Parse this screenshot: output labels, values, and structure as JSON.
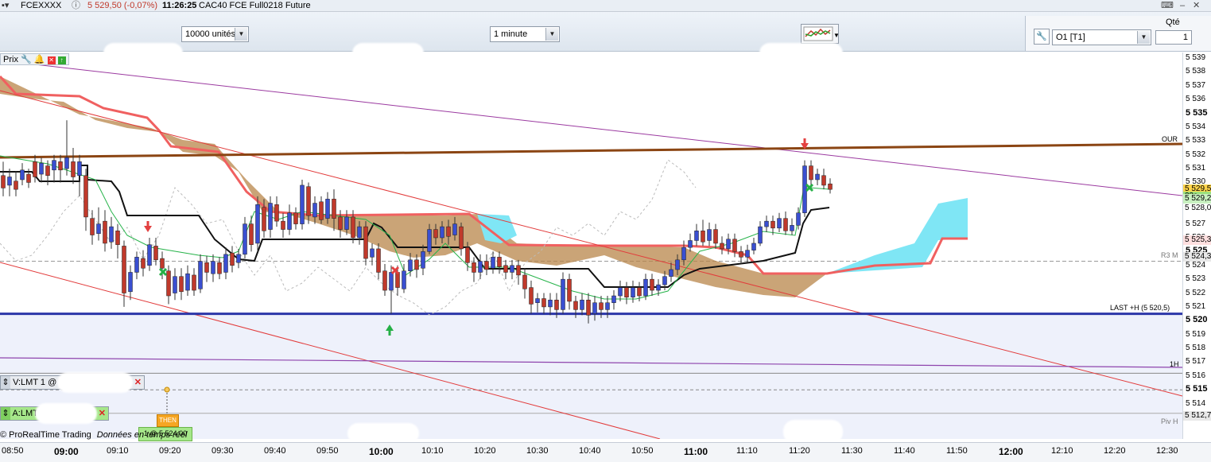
{
  "titlebar": {
    "instrument": "FCEXXXX",
    "price_change": "5 529,50 (-0,07%)",
    "time": "11:26:25",
    "description": "CAC40 FCE Full0218 Future"
  },
  "toolbar": {
    "units_select": "10000 unités",
    "interval_select": "1 minute",
    "account_select": "O1 [T1]",
    "qty_label": "Qté",
    "qty_value": "1"
  },
  "chart": {
    "panel_label": "Prix",
    "y_labels": [
      "5 539",
      "5 538",
      "5 537",
      "5 536",
      "5 535",
      "5 534",
      "5 533",
      "5 532",
      "5 531",
      "5 530",
      "5 529",
      "5 528",
      "5 527",
      "5 526",
      "5 525",
      "5 524",
      "5 523",
      "5 522",
      "5 521",
      "5 520",
      "5 519",
      "5 518",
      "5 517",
      "5 516",
      "5 515",
      "5 514",
      "5 513"
    ],
    "y_bold": [
      "5 535",
      "5 525",
      "5 520",
      "5 515"
    ],
    "price_tags": [
      {
        "text": "5 529,5",
        "bg": "#ffd54a",
        "y": 5529.5
      },
      {
        "text": "33s",
        "bg": "#9be07a",
        "y": 5529.0
      },
      {
        "text": "5 529,2",
        "bg": "#c8f0c0",
        "y": 5528.8
      },
      {
        "text": "5 528,0",
        "bg": "#ffffff",
        "y": 5528.1
      },
      {
        "text": "5 525,3",
        "bg": "#ffe0e0",
        "y": 5525.8
      },
      {
        "text": "5 524,3",
        "bg": "#e8e8e8",
        "y": 5524.6
      },
      {
        "text": "5 512,7",
        "bg": "#e8e8e8",
        "y": 5513.1
      }
    ],
    "line_labels": {
      "our": "OUR",
      "r3": "R3 M",
      "last_h": "LAST +H (5 520,5)",
      "one_h": "1H",
      "piv": "Piv H"
    },
    "x_labels": [
      "08:50",
      "09:00",
      "09:10",
      "09:20",
      "09:30",
      "09:40",
      "09:50",
      "10:00",
      "10:10",
      "10:20",
      "10:30",
      "10:40",
      "10:50",
      "11:00",
      "11:10",
      "11:20",
      "11:30",
      "11:40",
      "11:50",
      "12:00",
      "12:10",
      "12:20",
      "12:30"
    ],
    "x_bold": [
      "09:00",
      "10:00",
      "11:00",
      "12:00"
    ],
    "colors": {
      "up": "#3a4fd1",
      "down": "#c0392b",
      "cloud_red": "#f06060",
      "cloud_fill": "#b8864a",
      "cloud_cyan": "#7fe6f5",
      "brown_line": "#8b4513",
      "blue_line": "#2b36a8"
    }
  },
  "orders": {
    "sell": "V:LMT  1 @",
    "buy": "A:LMT",
    "then": "THEN",
    "then_price": "1 @ 5 524,00"
  },
  "footer": {
    "copyright": "© ProRealTime Trading",
    "data_note": "Données en temps réel"
  }
}
